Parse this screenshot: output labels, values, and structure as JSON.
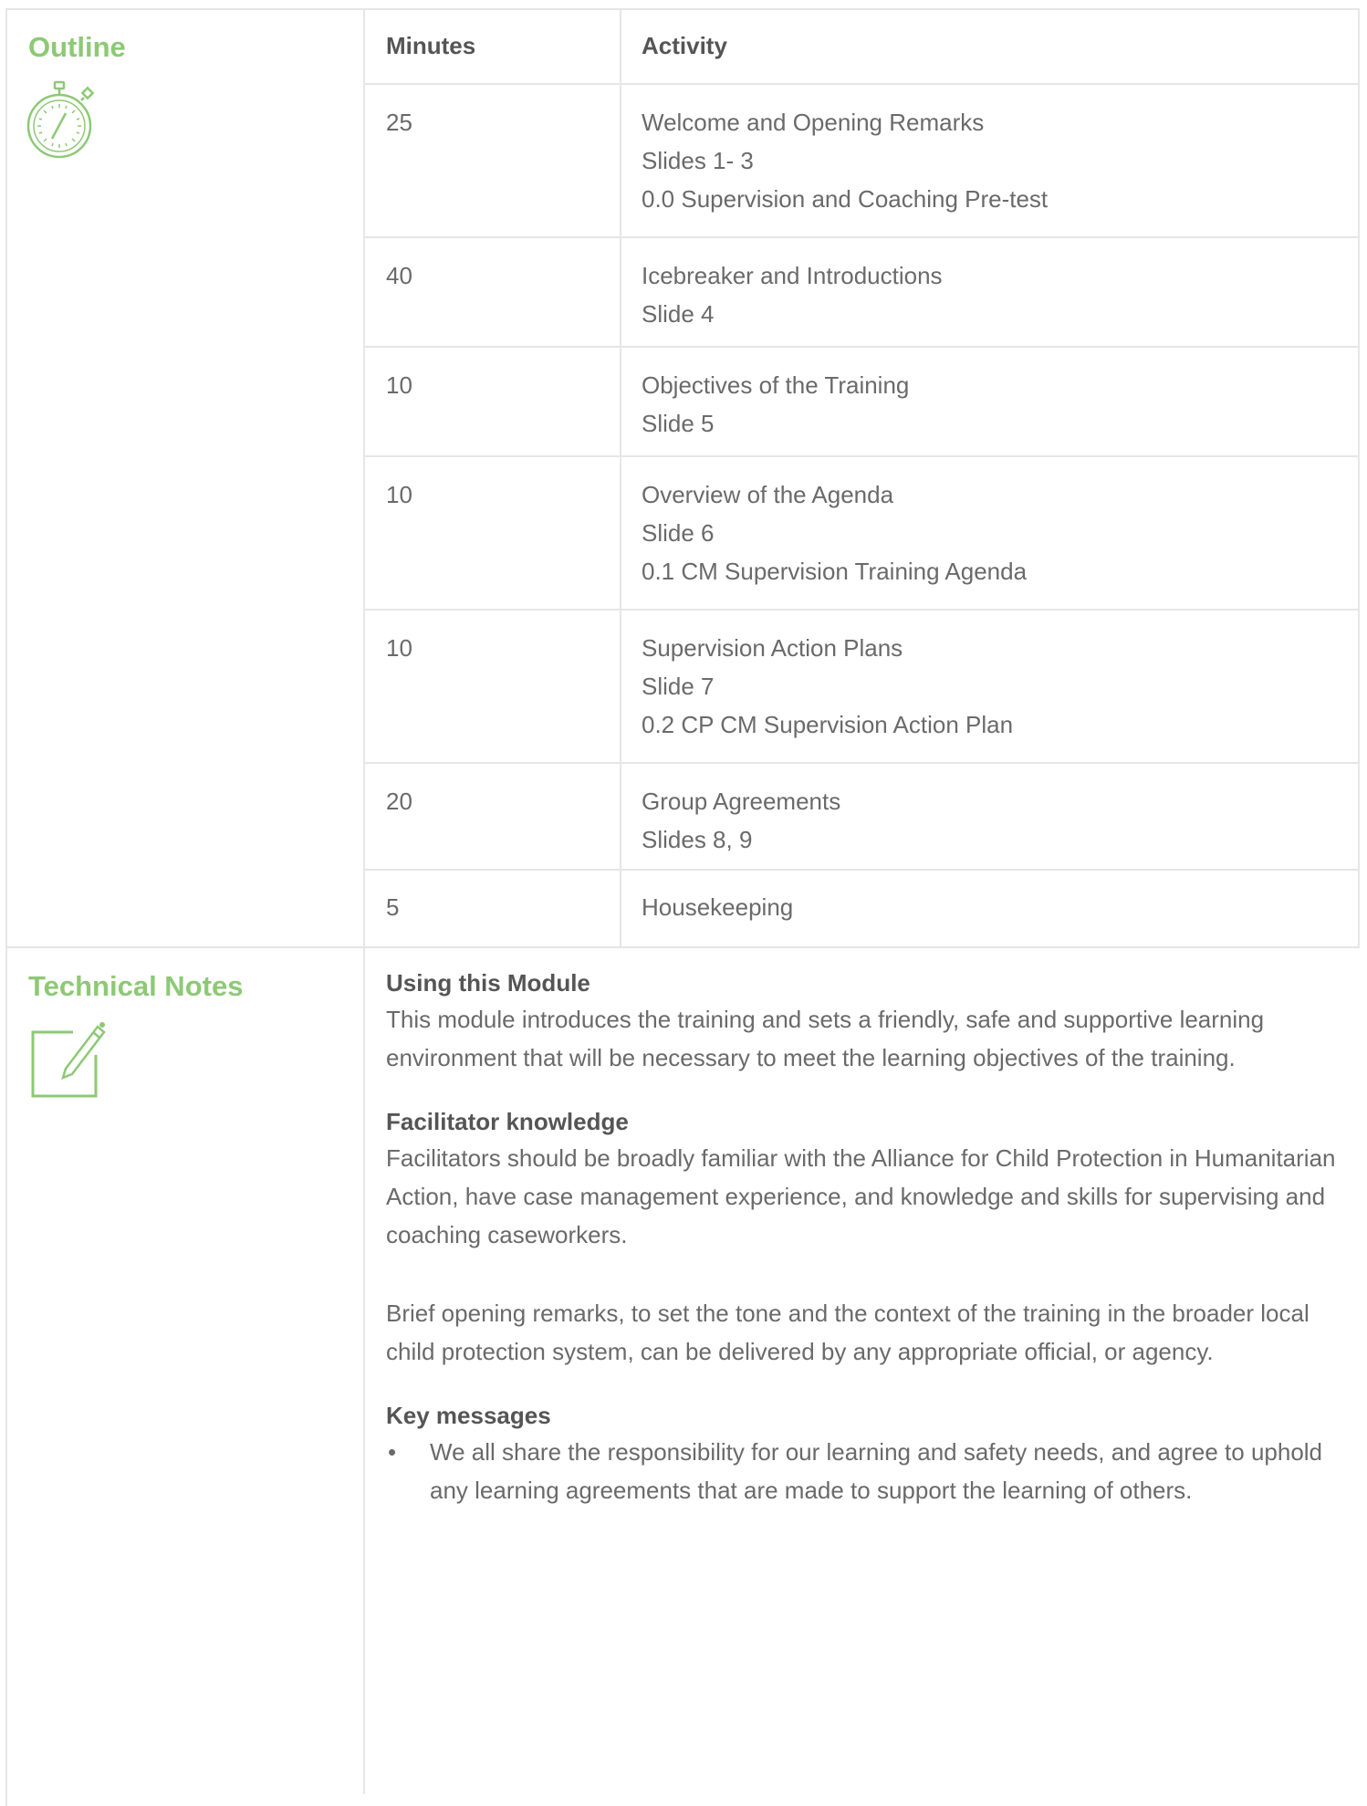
{
  "outline": {
    "title": "Outline",
    "icon": "stopwatch-icon",
    "table": {
      "headers": {
        "minutes": "Minutes",
        "activity": "Activity"
      },
      "rows": [
        {
          "minutes": "25",
          "lines": [
            "Welcome and Opening Remarks",
            "Slides 1- 3",
            "0.0 Supervision and Coaching Pre-test"
          ]
        },
        {
          "minutes": "40",
          "lines": [
            "Icebreaker and Introductions",
            "Slide 4"
          ]
        },
        {
          "minutes": "10",
          "lines": [
            "Objectives of the Training",
            "Slide 5"
          ]
        },
        {
          "minutes": "10",
          "lines": [
            "Overview of the Agenda",
            "Slide 6",
            "0.1 CM Supervision Training Agenda"
          ]
        },
        {
          "minutes": "10",
          "lines": [
            "Supervision Action Plans",
            "Slide 7",
            "0.2 CP CM Supervision Action Plan"
          ]
        },
        {
          "minutes": "20",
          "lines": [
            "Group Agreements",
            "Slides 8, 9"
          ]
        },
        {
          "minutes": "5",
          "lines": [
            "Housekeeping"
          ]
        }
      ]
    }
  },
  "technical_notes": {
    "title": "Technical Notes",
    "icon": "edit-note-icon",
    "using_heading": "Using this Module",
    "using_text": "This module introduces the training and sets a friendly, safe and supportive learning environment that will be necessary to meet the learning objectives of the training.",
    "facilitator_heading": "Facilitator knowledge",
    "facilitator_text": "Facilitators should be broadly familiar with the Alliance for Child Protection in Humanitarian Action, have case management experience, and knowledge and skills for supervising and coaching caseworkers.",
    "remarks_text": "Brief opening remarks, to set the tone and the context of the training in the broader local child protection system, can be delivered by any appropriate official, or agency.",
    "key_heading": "Key messages",
    "bullet_char": "•",
    "key_messages": [
      "We all share the responsibility for our learning and safety needs, and agree to uphold any learning agreements that are made to support the learning of others."
    ]
  },
  "colors": {
    "accent_green": "#8dc975",
    "grid": "#e6e6e6",
    "text": "#6a6a6a"
  }
}
